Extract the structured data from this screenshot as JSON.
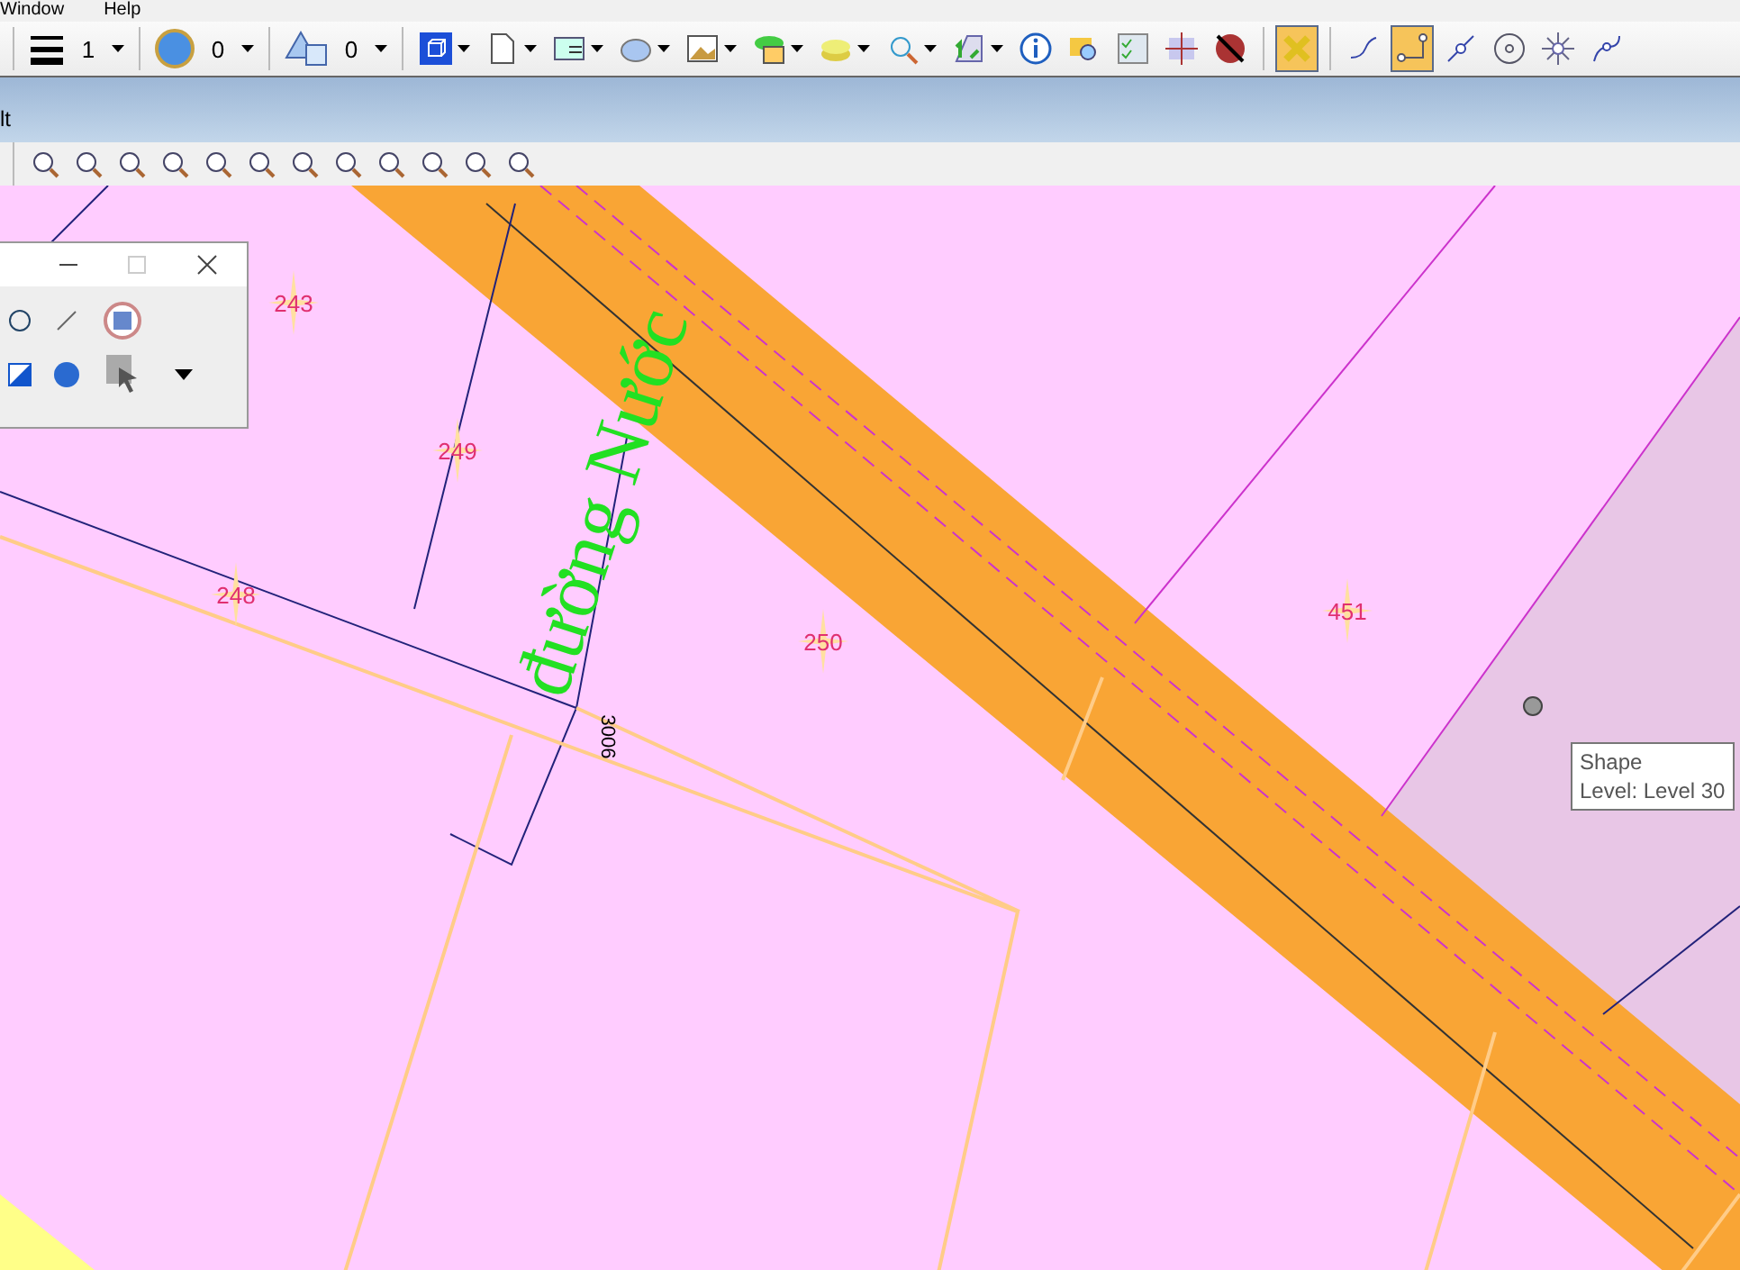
{
  "menu": [
    {
      "label": "Window"
    },
    {
      "label": "Help"
    }
  ],
  "toolbar": {
    "combos": [
      {
        "value": "1"
      },
      {
        "value": "0"
      },
      {
        "value": "0"
      }
    ],
    "buttons": [
      {
        "dropdown": true,
        "selected": false
      },
      {
        "dropdown": true,
        "selected": false
      },
      {
        "dropdown": true,
        "selected": false
      },
      {
        "dropdown": true,
        "selected": false
      },
      {
        "dropdown": true,
        "selected": false
      },
      {
        "dropdown": true,
        "selected": false
      },
      {
        "dropdown": true,
        "selected": false
      },
      {
        "dropdown": true,
        "selected": false
      },
      {
        "dropdown": true,
        "selected": false
      },
      {
        "dropdown": false,
        "selected": false
      },
      {
        "dropdown": false,
        "selected": false
      },
      {
        "dropdown": false,
        "selected": false
      },
      {
        "dropdown": false,
        "selected": false
      },
      {
        "dropdown": false,
        "selected": false
      },
      {
        "dropdown": false,
        "selected": true
      },
      {
        "dropdown": false,
        "selected": false
      },
      {
        "dropdown": false,
        "selected": true
      },
      {
        "dropdown": false,
        "selected": false
      },
      {
        "dropdown": false,
        "selected": false
      },
      {
        "dropdown": false,
        "selected": false
      },
      {
        "dropdown": false,
        "selected": false
      }
    ]
  },
  "view_title": "lt",
  "map": {
    "parcels": [
      {
        "number": "243"
      },
      {
        "number": "249"
      },
      {
        "number": "248"
      },
      {
        "number": "250"
      },
      {
        "number": "451"
      }
    ],
    "road_label": "đường Nước",
    "dimension": "3006"
  },
  "tooltip": {
    "lines": [
      "Shape",
      "Level: Level 30"
    ]
  }
}
